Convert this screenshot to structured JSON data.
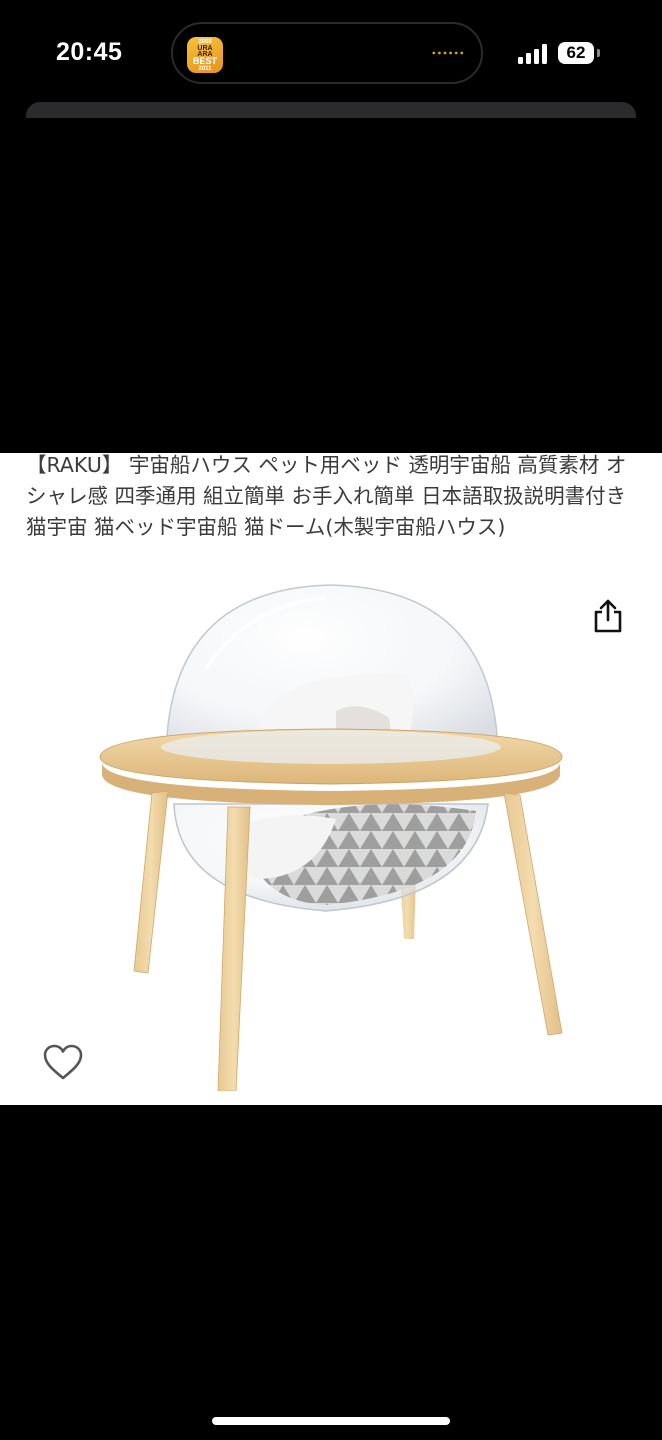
{
  "status_bar": {
    "time": "20:45",
    "battery_level": "62",
    "island_app_icon": {
      "line1": "2008",
      "line2": "URA",
      "line3": "ARA",
      "line4": "BEST",
      "line5": "2011"
    }
  },
  "product": {
    "title": "【RAKU】 宇宙船ハウス ペット用ベッド 透明宇宙船 高質素材 オシャレ感 四季通用 組立簡単 お手入れ簡単 日本語取扱説明書付き 猫宇宙 猫ベッド宇宙船 猫ドーム(木製宇宙船ハウス)"
  },
  "icons": {
    "share": "share-icon",
    "favorite": "heart-icon",
    "signal": "cellular-signal-icon",
    "battery": "battery-icon"
  }
}
